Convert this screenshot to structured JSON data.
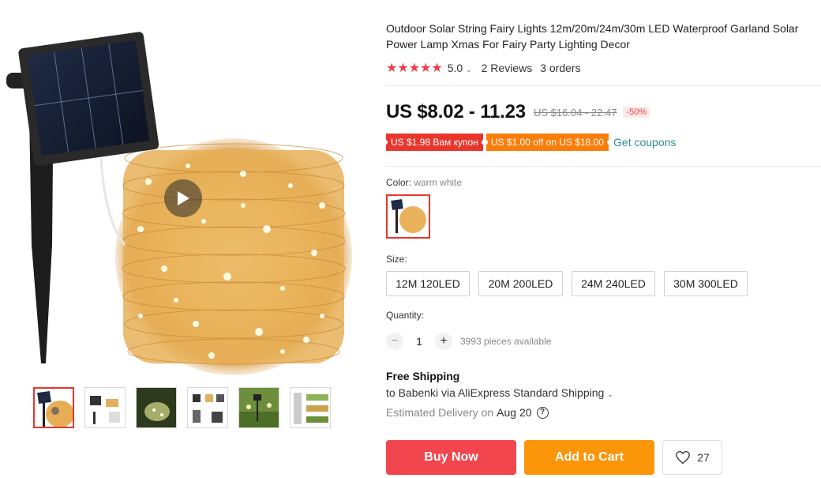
{
  "product": {
    "title": "Outdoor Solar String Fairy Lights 12m/20m/24m/30m LED Waterproof Garland Solar Power Lamp Xmas For Fairy Party Lighting Decor",
    "rating": {
      "stars": "★★★★★",
      "value": "5.0",
      "reviews": "2 Reviews",
      "orders": "3 orders"
    },
    "price": {
      "current": "US $8.02 - 11.23",
      "original": "US $16.04 - 22.47",
      "discount": "-50%"
    },
    "coupons": [
      {
        "text": "US $1.98 Вам купон",
        "color": "#e8362d"
      },
      {
        "text": "US $1.00 off on US $18.00",
        "color": "#fb7d0a"
      }
    ],
    "get_coupons": "Get coupons",
    "color": {
      "label": "Color:",
      "selected": "warm white"
    },
    "size": {
      "label": "Size:",
      "options": [
        "12M 120LED",
        "20M 200LED",
        "24M 240LED",
        "30M 300LED"
      ]
    },
    "quantity": {
      "label": "Quantity:",
      "value": "1",
      "available": "3993 pieces available",
      "minus": "−",
      "plus": "+"
    },
    "shipping": {
      "title": "Free Shipping",
      "line": "to Babenki via AliExpress Standard Shipping",
      "delivery_label": "Estimated Delivery on",
      "delivery_date": "Aug 20",
      "help": "?"
    },
    "actions": {
      "buy_now": "Buy Now",
      "add_to_cart": "Add to Cart",
      "wishlist_count": "27"
    }
  },
  "colors": {
    "accent_red": "#f2464f",
    "accent_orange": "#fb950a",
    "star": "#f03c4c",
    "coupon_link": "#2e8b8b"
  },
  "icons": [
    "play-icon",
    "star-icon",
    "chevron-down-icon",
    "minus-icon",
    "plus-icon",
    "help-icon",
    "heart-icon"
  ]
}
